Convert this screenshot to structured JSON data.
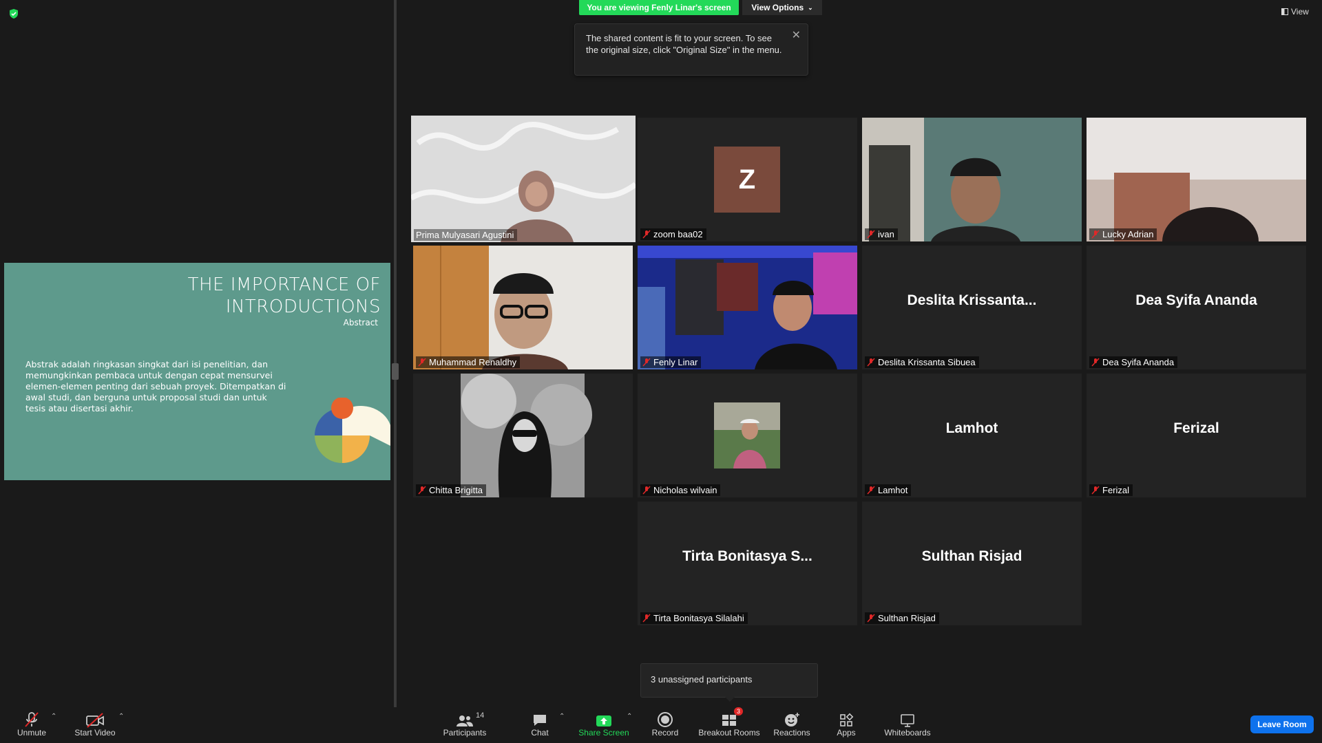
{
  "banner": {
    "viewing": "You are viewing Fenly Linar's screen",
    "view_options": "View Options"
  },
  "tooltip": {
    "text": "The shared content is fit to your screen. To see the original size, click \"Original Size\" in the menu."
  },
  "view_button": "View",
  "slide": {
    "title_line1": "THE IMPORTANCE OF",
    "title_line2": "INTRODUCTIONS",
    "subtitle": "Abstract",
    "body": "Abstrak adalah ringkasan singkat dari isi penelitian, dan memungkinkan pembaca untuk dengan cepat mensurvei elemen-elemen penting dari sebuah proyek. Ditempatkan di awal studi, dan berguna untuk proposal studi dan untuk tesis atau disertasi akhir."
  },
  "participants": [
    {
      "name": "Prima Mulyasari Agustini",
      "video": true,
      "speaking": true
    },
    {
      "name": "zoom baa02",
      "initial": "Z",
      "muted": true
    },
    {
      "name": "ivan",
      "video": true,
      "muted": true
    },
    {
      "name": "Lucky Adrian",
      "video": true,
      "muted": true
    },
    {
      "name": "Muhammad Renaldhy",
      "video": true,
      "muted": true
    },
    {
      "name": "Fenly Linar",
      "video": true,
      "muted": true
    },
    {
      "name": "Deslita Krissanta Sibuea",
      "display": "Deslita  Krissanta...",
      "muted": true
    },
    {
      "name": "Dea Syifa Ananda",
      "display": "Dea Syifa Ananda",
      "muted": true
    },
    {
      "name": "Chitta Brigitta",
      "video": true,
      "muted": true
    },
    {
      "name": "Nicholas wilvain",
      "video": true,
      "muted": true
    },
    {
      "name": "Lamhot",
      "display": "Lamhot",
      "muted": true
    },
    {
      "name": "Ferizal",
      "display": "Ferizal",
      "muted": true
    },
    {
      "name": "Tirta Bonitasya Silalahi",
      "display": "Tirta Bonitasya S...",
      "muted": true
    },
    {
      "name": "Sulthan Risjad",
      "display": "Sulthan Risjad",
      "muted": true
    }
  ],
  "unassigned": "3 unassigned participants",
  "toolbar": {
    "unmute": "Unmute",
    "start_video": "Start Video",
    "participants": "Participants",
    "participants_count": "14",
    "chat": "Chat",
    "share_screen": "Share Screen",
    "record": "Record",
    "breakout_rooms": "Breakout Rooms",
    "breakout_badge": "3",
    "reactions": "Reactions",
    "apps": "Apps",
    "whiteboards": "Whiteboards",
    "leave_room": "Leave Room"
  },
  "colors": {
    "accent": "#0e72ed",
    "share_green": "#23d959",
    "speaker_border": "#e2e83a",
    "mute_red": "#e02828"
  }
}
